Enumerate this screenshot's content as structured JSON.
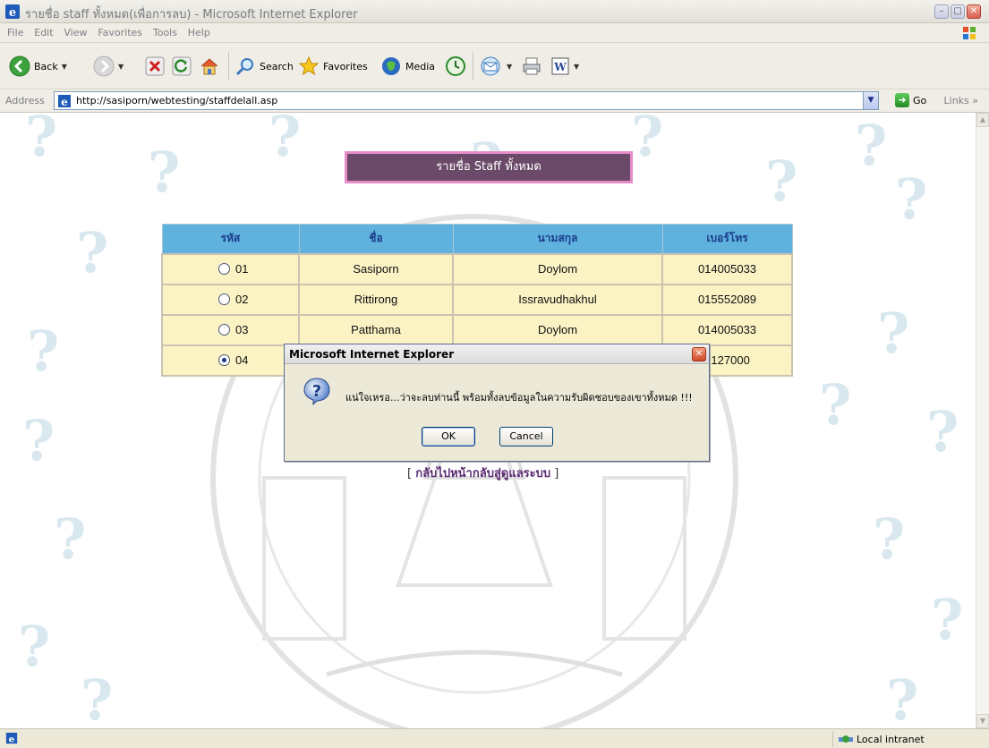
{
  "window": {
    "title": "รายชื่อ staff ทั้งหมด(เพื่อการลบ) - Microsoft Internet Explorer"
  },
  "menu": [
    "File",
    "Edit",
    "View",
    "Favorites",
    "Tools",
    "Help"
  ],
  "toolbar": {
    "back_label": "Back",
    "search_label": "Search",
    "favorites_label": "Favorites",
    "media_label": "Media"
  },
  "address": {
    "label": "Address",
    "url": "http://sasiporn/webtesting/staffdelall.asp",
    "go_label": "Go",
    "links_label": "Links »"
  },
  "page": {
    "title": "รายชื่อ Staff ทั้งหมด",
    "table": {
      "headers": [
        "รหัส",
        "ชื่อ",
        "นามสกุล",
        "เบอร์โทร"
      ],
      "rows": [
        {
          "code": "01",
          "first": "Sasiporn",
          "last": "Doylom",
          "phone": "014005033",
          "selected": false
        },
        {
          "code": "02",
          "first": "Rittirong",
          "last": "Issravudhakhul",
          "phone": "015552089",
          "selected": false
        },
        {
          "code": "03",
          "first": "Patthama",
          "last": "Doylom",
          "phone": "014005033",
          "selected": false
        },
        {
          "code": "04",
          "first": "",
          "last": "",
          "phone": "7127000",
          "selected": true
        }
      ]
    },
    "back_link": {
      "open": "[",
      "text": "กลับไปหน้ากลับสู่ดูแลระบบ",
      "close": "]"
    }
  },
  "dialog": {
    "title": "Microsoft Internet Explorer",
    "message": "แน่ใจเหรอ...ว่าจะลบท่านนี้ พร้อมทั้งลบข้อมูลในความรับผิดชอบของเขาทั้งหมด !!!",
    "ok_label": "OK",
    "cancel_label": "Cancel"
  },
  "status": {
    "zone": "Local intranet"
  },
  "colors": {
    "title_box": "#6a4a68",
    "title_border": "#e68cc8",
    "table_header": "#5fb2de",
    "table_row": "#fbf3c4"
  }
}
